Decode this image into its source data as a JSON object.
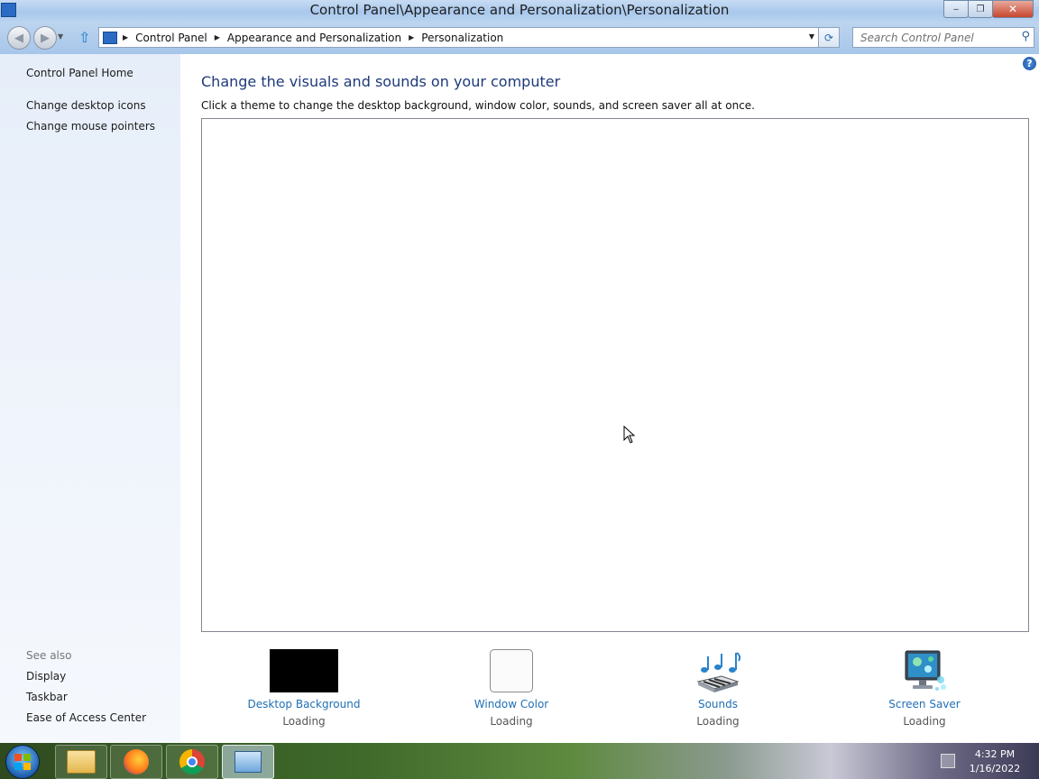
{
  "window": {
    "title": "Control Panel\\Appearance and Personalization\\Personalization",
    "controls": {
      "minimize": "‒",
      "maximize": "❐",
      "close": "✕"
    }
  },
  "navigation": {
    "back_icon": "back-arrow-icon",
    "forward_icon": "forward-arrow-icon",
    "up_icon": "up-arrow-icon",
    "breadcrumbs": [
      "Control Panel",
      "Appearance and Personalization",
      "Personalization"
    ],
    "search": {
      "placeholder": "Search Control Panel",
      "value": ""
    }
  },
  "sidebar": {
    "top_links": [
      "Control Panel Home",
      "Change desktop icons",
      "Change mouse pointers"
    ],
    "see_also_label": "See also",
    "see_also_links": [
      "Display",
      "Taskbar",
      "Ease of Access Center"
    ]
  },
  "main": {
    "heading": "Change the visuals and sounds on your computer",
    "subtext": "Click a theme to change the desktop background, window color, sounds, and screen saver all at once.",
    "tiles": [
      {
        "label": "Desktop Background",
        "status": "Loading",
        "icon": "desktop-background-thumbnail"
      },
      {
        "label": "Window Color",
        "status": "Loading",
        "icon": "window-color-swatch"
      },
      {
        "label": "Sounds",
        "status": "Loading",
        "icon": "music-notes-piano-icon"
      },
      {
        "label": "Screen Saver",
        "status": "Loading",
        "icon": "monitor-screensaver-icon"
      }
    ]
  },
  "taskbar": {
    "apps": [
      "file-explorer-icon",
      "firefox-icon",
      "chrome-icon",
      "control-panel-icon"
    ],
    "active_app": "control-panel-icon",
    "clock": {
      "time": "4:32 PM",
      "date": "1/16/2022"
    }
  },
  "colors": {
    "link": "#1f6fb5",
    "heading": "#1e3a7a",
    "sidebar_bg": "#e6eef9"
  }
}
